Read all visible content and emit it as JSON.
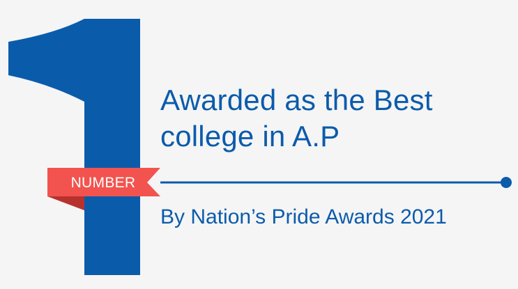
{
  "badge": {
    "numeral": "1",
    "ribbon_label": "NUMBER"
  },
  "headline": {
    "line1": "Awarded as the Best",
    "line2": "college in A.P"
  },
  "subline": "By Nation’s Pride Awards 2021",
  "colors": {
    "background": "#f5f5f5",
    "brand_blue": "#0b5bab",
    "ribbon_red": "#f2534e",
    "ribbon_shadow": "#c03a36"
  }
}
